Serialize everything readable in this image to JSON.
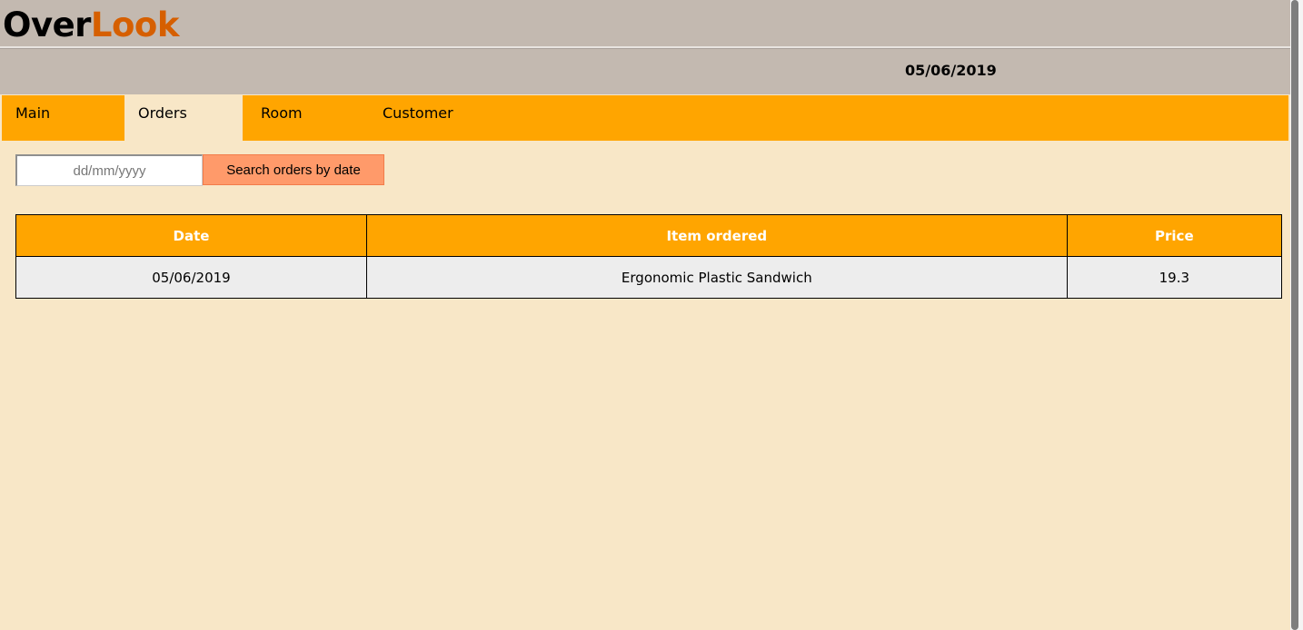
{
  "app": {
    "brand_part1": "Over",
    "brand_part2": "Look",
    "brand_colors": {
      "part1": "#000000",
      "part2": "#d65f00"
    },
    "current_date": "05/06/2019"
  },
  "tabs": [
    {
      "label": "Main",
      "active": false
    },
    {
      "label": "Orders",
      "active": true
    },
    {
      "label": "Room",
      "active": false
    },
    {
      "label": "Customer",
      "active": false
    }
  ],
  "search": {
    "placeholder": "dd/mm/yyyy",
    "value": "",
    "button_label": "Search orders by date"
  },
  "orders_table": {
    "headers": [
      "Date",
      "Item ordered",
      "Price"
    ],
    "rows": [
      [
        "05/06/2019",
        "Ergonomic Plastic Sandwich",
        "19.3"
      ]
    ]
  },
  "colors": {
    "header_bg": "#c3b9b0",
    "tab_bar": "#ffa500",
    "content_bg": "#f8e7c7",
    "button_bg": "#ff9a6a",
    "table_header": "#ffa500",
    "table_row": "#ededed"
  }
}
